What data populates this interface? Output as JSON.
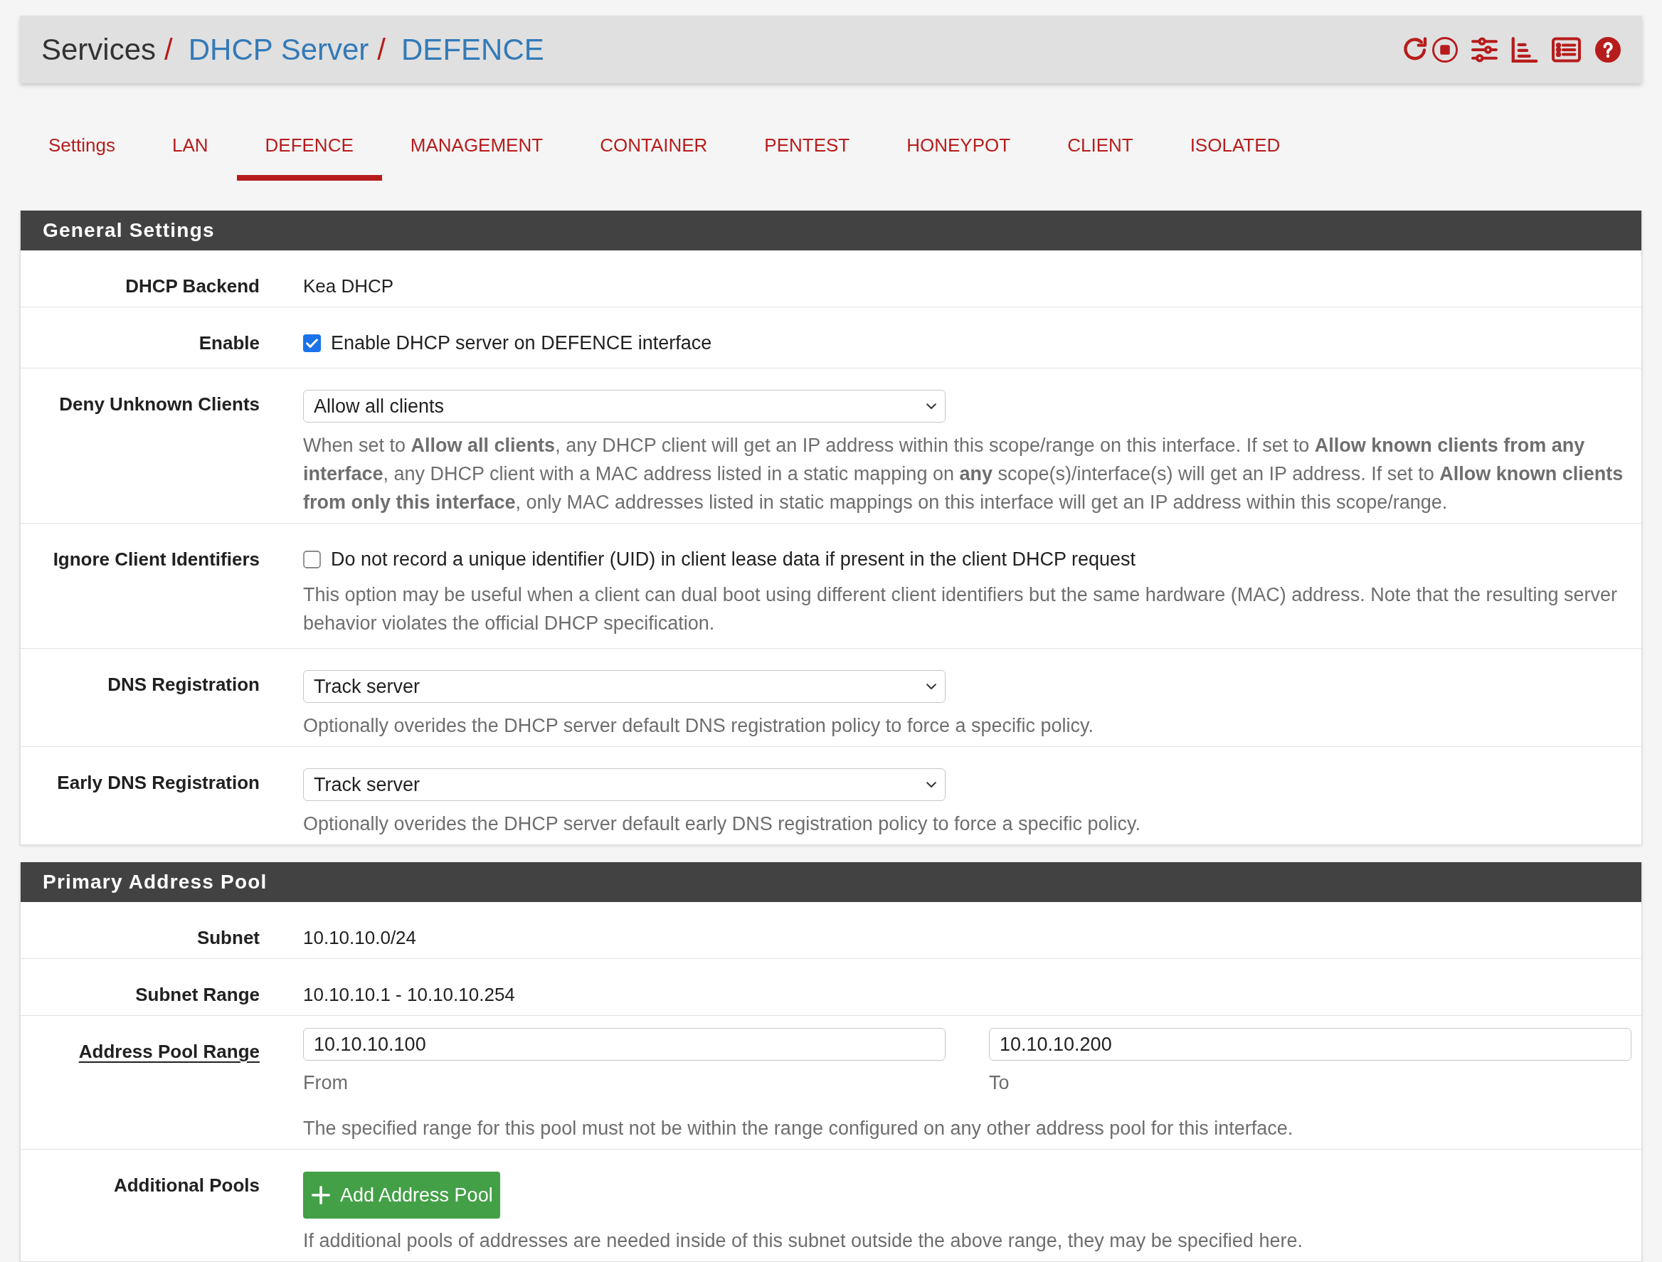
{
  "breadcrumb": [
    {
      "label": "Services",
      "kind": "text",
      "separator": "/"
    },
    {
      "label": "DHCP Server",
      "kind": "link",
      "separator": "/"
    },
    {
      "label": "DEFENCE",
      "kind": "link"
    }
  ],
  "tabs": [
    {
      "label": "Settings",
      "selected": false
    },
    {
      "label": "LAN",
      "selected": false
    },
    {
      "label": "DEFENCE",
      "selected": true
    },
    {
      "label": "MANAGEMENT",
      "selected": false
    },
    {
      "label": "CONTAINER",
      "selected": false
    },
    {
      "label": "PENTEST",
      "selected": false
    },
    {
      "label": "HONEYPOT",
      "selected": false
    },
    {
      "label": "CLIENT",
      "selected": false
    },
    {
      "label": "ISOLATED",
      "selected": false
    }
  ],
  "sections": [
    {
      "title": "General Settings",
      "rows": [
        {
          "label": "DHCP Backend",
          "label_link": false,
          "kind": "text",
          "value": "Kea DHCP"
        },
        {
          "label": "Enable",
          "label_link": false,
          "kind": "checkbox",
          "checked": true,
          "text": "Enable DHCP server on DEFENCE interface"
        },
        {
          "label": "Deny Unknown Clients",
          "label_link": false,
          "kind": "select",
          "value": "Allow all clients",
          "help": "When set to **Allow all clients**, any DHCP client will get an IP address within this scope/range on this interface. If set to **Allow known clients from any interface**, any DHCP client with a MAC address listed in a static mapping on **any** scope(s)/interface(s) will get an IP address. If set to **Allow known clients from only this interface**, only MAC addresses listed in static mappings on this interface will get an IP address within this scope/range."
        },
        {
          "label": "Ignore Client Identifiers",
          "label_link": false,
          "kind": "checkbox",
          "checked": false,
          "text": "Do not record a unique identifier (UID) in client lease data if present in the client DHCP request",
          "help": "This option may be useful when a client can dual boot using different client identifiers but the same hardware (MAC) address. Note that the resulting server behavior violates the official DHCP specification."
        },
        {
          "label": "DNS Registration",
          "label_link": false,
          "kind": "select",
          "value": "Track server",
          "help": "Optionally overides the DHCP server default DNS registration policy to force a specific policy."
        },
        {
          "label": "Early DNS Registration",
          "label_link": false,
          "kind": "select",
          "value": "Track server",
          "help": "Optionally overides the DHCP server default early DNS registration policy to force a specific policy."
        }
      ]
    },
    {
      "title": "Primary Address Pool",
      "rows": [
        {
          "label": "Subnet",
          "label_link": false,
          "kind": "text",
          "value": "10.10.10.0/24"
        },
        {
          "label": "Subnet Range",
          "label_link": false,
          "kind": "text",
          "value": "10.10.10.1 - 10.10.10.254"
        },
        {
          "label": "Address Pool Range",
          "label_link": true,
          "kind": "range",
          "fields": [
            {
              "value": "10.10.10.100",
              "caption": "From"
            },
            {
              "value": "10.10.10.200",
              "caption": "To"
            }
          ],
          "help": "The specified range for this pool must not be within the range configured on any other address pool for this interface."
        },
        {
          "label": "Additional Pools",
          "label_link": false,
          "kind": "button",
          "button": "Add Address Pool",
          "help": "If additional pools of addresses are needed inside of this subnet outside the above range, they may be specified here."
        }
      ]
    }
  ]
}
